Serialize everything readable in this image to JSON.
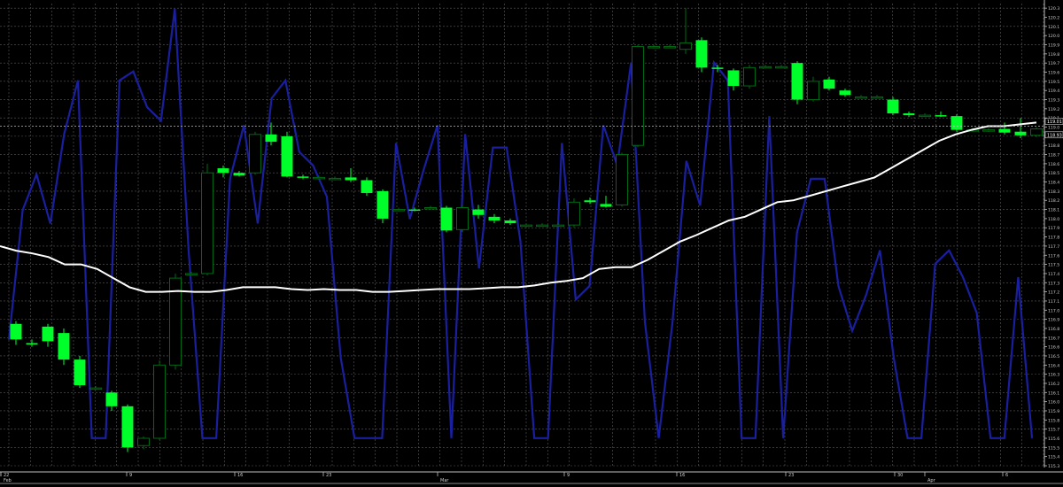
{
  "chart_data": {
    "type": "candlestick",
    "y_axis": {
      "position": "right",
      "ticks": [
        115.3,
        115.5,
        115.7,
        115.9,
        116.1,
        116.3,
        116.5,
        116.7,
        116.9,
        117.1,
        117.3,
        117.5,
        117.7,
        117.9,
        118.1,
        118.3,
        118.5,
        118.7,
        118.9,
        119.1,
        119.3,
        119.5,
        119.7,
        119.9,
        120.1,
        120.3
      ],
      "tick_labels": [
        "115.3",
        "115.4",
        "115.5",
        "115.6",
        "115.7",
        "115.8",
        "115.9",
        "116.0",
        "116.1",
        "116.2",
        "116.3",
        "116.4",
        "116.5",
        "116.6",
        "116.7",
        "116.8",
        "116.9",
        "117.0",
        "117.1",
        "117.2",
        "117.3",
        "117.4",
        "117.5",
        "117.6",
        "117.7",
        "117.8",
        "117.9",
        "118.0",
        "118.1",
        "118.2",
        "118.3",
        "118.4",
        "118.5",
        "118.6",
        "118.7",
        "118.8",
        "118.9",
        "119.0",
        "119.1",
        "119.2",
        "119.3",
        "119.4",
        "119.5",
        "119.6",
        "119.7",
        "119.8",
        "119.9",
        "120.0",
        "120.1",
        "120.2",
        "120.3"
      ],
      "range": [
        115.3,
        120.35
      ],
      "current_price_labels": [
        "119.01",
        "118.93"
      ]
    },
    "x_axis": {
      "labels": [
        "22",
        "Feb",
        "9",
        "16",
        "23",
        "Mar",
        "9",
        "16",
        "23",
        "30",
        "Apr",
        "6"
      ]
    },
    "grid": true,
    "colors": {
      "background": "#000000",
      "grid": "#5a5a5a",
      "bear_candle": "#00ff2a",
      "bull_candle": "#006a14",
      "indicator_line": "#1a1f9e",
      "moving_average": "#ffffff"
    },
    "candles": [
      {
        "o": 116.85,
        "h": 116.88,
        "l": 116.62,
        "c": 116.68
      },
      {
        "o": 116.64,
        "h": 116.68,
        "l": 116.6,
        "c": 116.63
      },
      {
        "o": 116.82,
        "h": 116.85,
        "l": 116.6,
        "c": 116.66
      },
      {
        "o": 116.75,
        "h": 116.8,
        "l": 116.4,
        "c": 116.46
      },
      {
        "o": 116.46,
        "h": 116.5,
        "l": 116.15,
        "c": 116.18
      },
      {
        "o": 116.15,
        "h": 116.17,
        "l": 116.13,
        "c": 116.15
      },
      {
        "o": 116.1,
        "h": 116.12,
        "l": 115.9,
        "c": 115.95
      },
      {
        "o": 115.95,
        "h": 115.97,
        "l": 115.45,
        "c": 115.5
      },
      {
        "o": 115.52,
        "h": 115.62,
        "l": 115.48,
        "c": 115.6
      },
      {
        "o": 115.6,
        "h": 116.45,
        "l": 115.58,
        "c": 116.4
      },
      {
        "o": 116.4,
        "h": 117.4,
        "l": 116.35,
        "c": 117.35
      },
      {
        "o": 117.4,
        "h": 117.42,
        "l": 117.38,
        "c": 117.4
      },
      {
        "o": 117.4,
        "h": 118.6,
        "l": 117.38,
        "c": 118.5
      },
      {
        "o": 118.55,
        "h": 118.58,
        "l": 118.45,
        "c": 118.5
      },
      {
        "o": 118.5,
        "h": 118.52,
        "l": 118.46,
        "c": 118.47
      },
      {
        "o": 118.5,
        "h": 118.95,
        "l": 118.48,
        "c": 118.92
      },
      {
        "o": 118.92,
        "h": 119.05,
        "l": 118.8,
        "c": 118.84
      },
      {
        "o": 118.9,
        "h": 118.95,
        "l": 118.45,
        "c": 118.46
      },
      {
        "o": 118.46,
        "h": 118.48,
        "l": 118.43,
        "c": 118.45
      },
      {
        "o": 118.45,
        "h": 118.47,
        "l": 118.43,
        "c": 118.45
      },
      {
        "o": 118.44,
        "h": 118.46,
        "l": 118.42,
        "c": 118.44
      },
      {
        "o": 118.45,
        "h": 118.55,
        "l": 118.4,
        "c": 118.42
      },
      {
        "o": 118.42,
        "h": 118.45,
        "l": 118.25,
        "c": 118.28
      },
      {
        "o": 118.3,
        "h": 118.32,
        "l": 117.95,
        "c": 118.0
      },
      {
        "o": 118.1,
        "h": 118.12,
        "l": 118.08,
        "c": 118.1
      },
      {
        "o": 118.1,
        "h": 118.12,
        "l": 118.08,
        "c": 118.09
      },
      {
        "o": 118.12,
        "h": 118.14,
        "l": 118.1,
        "c": 118.12
      },
      {
        "o": 118.12,
        "h": 118.14,
        "l": 117.85,
        "c": 117.87
      },
      {
        "o": 117.88,
        "h": 118.15,
        "l": 117.85,
        "c": 118.12
      },
      {
        "o": 118.1,
        "h": 118.15,
        "l": 118.0,
        "c": 118.04
      },
      {
        "o": 118.02,
        "h": 118.05,
        "l": 117.95,
        "c": 117.98
      },
      {
        "o": 117.98,
        "h": 118.0,
        "l": 117.93,
        "c": 117.95
      },
      {
        "o": 117.93,
        "h": 117.95,
        "l": 117.91,
        "c": 117.93
      },
      {
        "o": 117.93,
        "h": 117.95,
        "l": 117.91,
        "c": 117.93
      },
      {
        "o": 117.93,
        "h": 117.95,
        "l": 117.91,
        "c": 117.93
      },
      {
        "o": 117.93,
        "h": 118.22,
        "l": 117.9,
        "c": 118.18
      },
      {
        "o": 118.2,
        "h": 118.23,
        "l": 118.16,
        "c": 118.18
      },
      {
        "o": 118.16,
        "h": 118.25,
        "l": 118.12,
        "c": 118.13
      },
      {
        "o": 118.15,
        "h": 118.72,
        "l": 118.13,
        "c": 118.7
      },
      {
        "o": 118.8,
        "h": 119.9,
        "l": 118.78,
        "c": 119.88
      },
      {
        "o": 119.88,
        "h": 119.9,
        "l": 119.86,
        "c": 119.88
      },
      {
        "o": 119.88,
        "h": 119.9,
        "l": 119.86,
        "c": 119.88
      },
      {
        "o": 119.85,
        "h": 120.3,
        "l": 119.8,
        "c": 119.92
      },
      {
        "o": 119.95,
        "h": 119.98,
        "l": 119.6,
        "c": 119.65
      },
      {
        "o": 119.65,
        "h": 119.68,
        "l": 119.6,
        "c": 119.64
      },
      {
        "o": 119.62,
        "h": 119.64,
        "l": 119.4,
        "c": 119.45
      },
      {
        "o": 119.45,
        "h": 119.68,
        "l": 119.42,
        "c": 119.65
      },
      {
        "o": 119.66,
        "h": 119.68,
        "l": 119.64,
        "c": 119.66
      },
      {
        "o": 119.66,
        "h": 119.68,
        "l": 119.64,
        "c": 119.66
      },
      {
        "o": 119.7,
        "h": 119.72,
        "l": 119.25,
        "c": 119.3
      },
      {
        "o": 119.3,
        "h": 119.55,
        "l": 119.28,
        "c": 119.5
      },
      {
        "o": 119.52,
        "h": 119.55,
        "l": 119.4,
        "c": 119.42
      },
      {
        "o": 119.4,
        "h": 119.42,
        "l": 119.33,
        "c": 119.35
      },
      {
        "o": 119.33,
        "h": 119.35,
        "l": 119.31,
        "c": 119.33
      },
      {
        "o": 119.33,
        "h": 119.35,
        "l": 119.31,
        "c": 119.33
      },
      {
        "o": 119.3,
        "h": 119.33,
        "l": 119.13,
        "c": 119.15
      },
      {
        "o": 119.15,
        "h": 119.17,
        "l": 119.11,
        "c": 119.13
      },
      {
        "o": 119.13,
        "h": 119.15,
        "l": 119.11,
        "c": 119.13
      },
      {
        "o": 119.13,
        "h": 119.17,
        "l": 119.11,
        "c": 119.12
      },
      {
        "o": 119.12,
        "h": 119.14,
        "l": 118.95,
        "c": 118.97
      },
      {
        "o": 118.97,
        "h": 118.99,
        "l": 118.95,
        "c": 118.97
      },
      {
        "o": 118.97,
        "h": 118.99,
        "l": 118.95,
        "c": 118.97
      },
      {
        "o": 118.98,
        "h": 119.05,
        "l": 118.92,
        "c": 118.94
      },
      {
        "o": 118.95,
        "h": 119.1,
        "l": 118.88,
        "c": 118.91
      },
      {
        "o": 118.91,
        "h": 119.0,
        "l": 118.89,
        "c": 118.98
      }
    ],
    "series": [
      {
        "style": "moving-average",
        "values": [
          117.7,
          117.65,
          117.62,
          117.58,
          117.5,
          117.5,
          117.45,
          117.35,
          117.25,
          117.2,
          117.2,
          117.21,
          117.2,
          117.2,
          117.22,
          117.25,
          117.25,
          117.25,
          117.23,
          117.22,
          117.23,
          117.22,
          117.22,
          117.2,
          117.2,
          117.21,
          117.22,
          117.23,
          117.23,
          117.23,
          117.24,
          117.25,
          117.25,
          117.27,
          117.3,
          117.32,
          117.35,
          117.45,
          117.47,
          117.47,
          117.55,
          117.65,
          117.75,
          117.82,
          117.9,
          117.98,
          118.02,
          118.1,
          118.18,
          118.2,
          118.25,
          118.3,
          118.35,
          118.4,
          118.45,
          118.55,
          118.65,
          118.75,
          118.85,
          118.92,
          118.97,
          119.01,
          119.01,
          119.03,
          119.05
        ]
      },
      {
        "style": "oscillator",
        "range": [
          0,
          100
        ],
        "values": [
          26,
          55,
          63,
          52,
          72,
          84,
          4,
          4,
          84,
          86,
          78,
          75,
          100,
          46,
          4,
          4,
          62,
          74,
          52,
          80,
          84,
          68,
          65,
          58,
          22,
          4,
          4,
          4,
          70,
          53,
          64,
          74,
          4,
          72,
          42,
          69,
          69,
          48,
          4,
          4,
          70,
          35,
          38,
          74,
          65,
          88,
          30,
          4,
          30,
          66,
          56,
          88,
          84,
          4,
          4,
          76,
          4,
          50,
          62,
          62,
          38,
          28,
          36,
          46,
          22,
          4,
          4,
          43,
          46,
          40,
          32,
          4,
          4,
          40,
          4
        ]
      }
    ]
  }
}
